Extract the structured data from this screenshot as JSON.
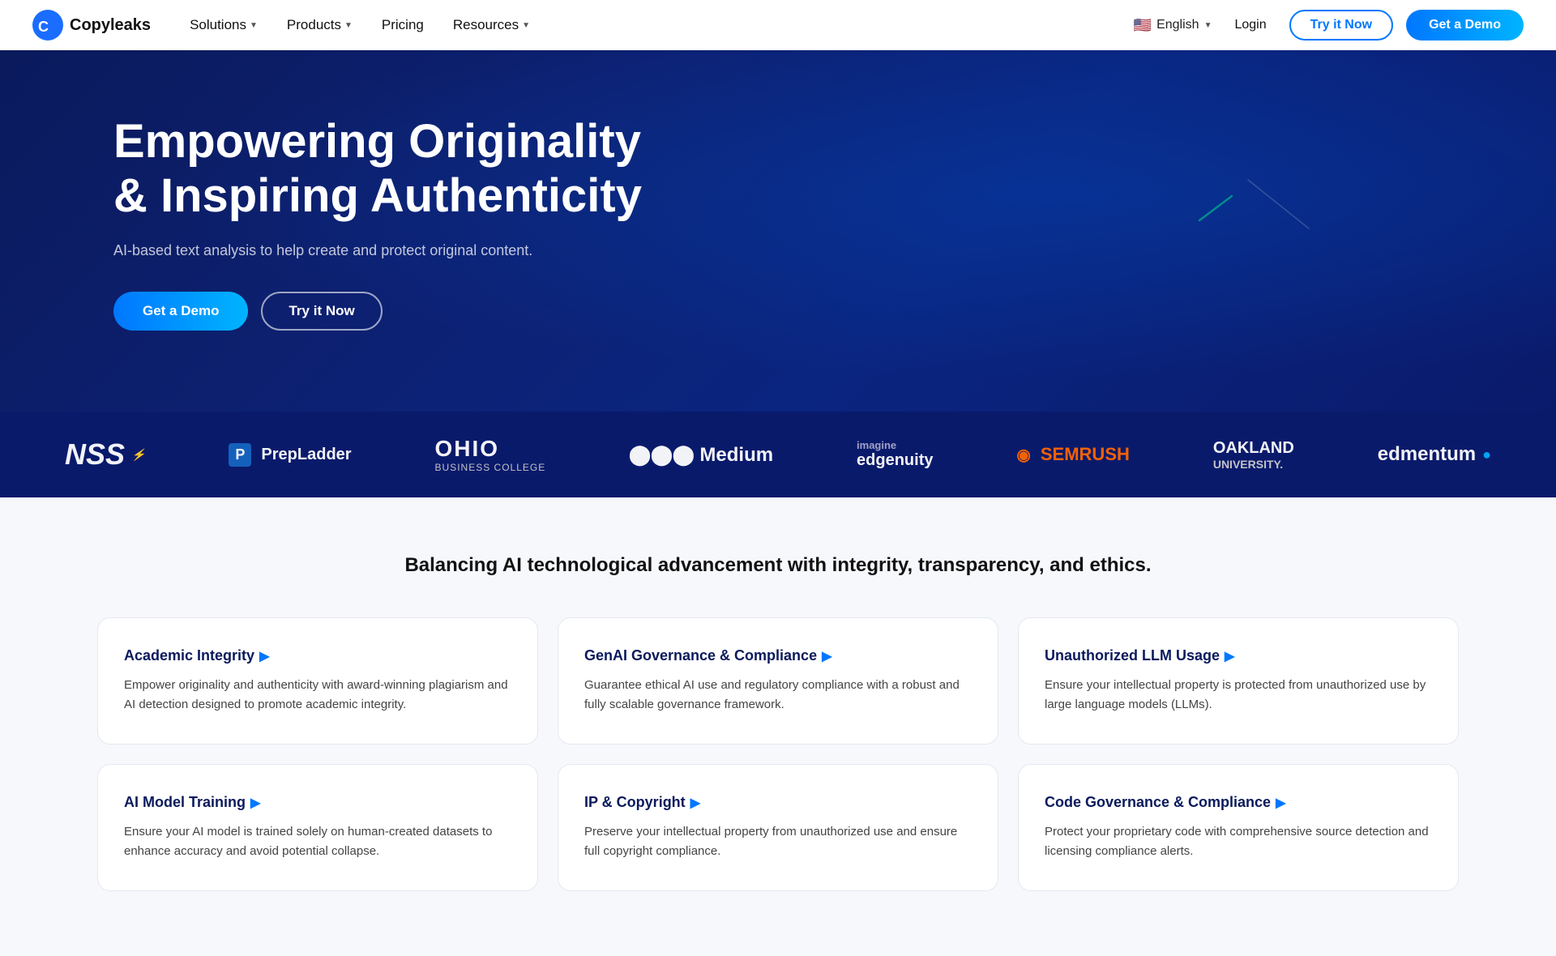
{
  "navbar": {
    "logo_text": "Copyleaks",
    "nav_items": [
      {
        "label": "Solutions",
        "has_dropdown": true
      },
      {
        "label": "Products",
        "has_dropdown": true
      },
      {
        "label": "Pricing",
        "has_dropdown": false
      },
      {
        "label": "Resources",
        "has_dropdown": true
      }
    ],
    "lang": "English",
    "login_label": "Login",
    "try_label": "Try it Now",
    "demo_label": "Get a Demo"
  },
  "hero": {
    "title_line1": "Empowering Originality",
    "title_line2": "& Inspiring Authenticity",
    "subtitle": "AI-based text analysis to help create and protect original content.",
    "demo_btn": "Get a Demo",
    "try_btn": "Try it Now"
  },
  "logos": [
    {
      "name": "NSS",
      "style": "nss"
    },
    {
      "name": "PrepLadder",
      "style": "prepladder"
    },
    {
      "name": "OHIO BUSINESS COLLEGE",
      "style": "ohio"
    },
    {
      "name": "⬤⬤⬤ Medium",
      "style": "medium"
    },
    {
      "name": "≡ imagine edgenuity",
      "style": "edgenuity"
    },
    {
      "name": "SEMRUSH",
      "style": "semrush"
    },
    {
      "name": "OAKLAND UNIVERSITY",
      "style": "oakland"
    },
    {
      "name": "edmentum",
      "style": "edmentum"
    }
  ],
  "features": {
    "headline": "Balancing AI technological advancement with integrity, transparency, and ethics.",
    "cards": [
      {
        "title": "Academic Integrity",
        "desc": "Empower originality and authenticity with award-winning plagiarism and AI detection designed to promote academic integrity."
      },
      {
        "title": "GenAI Governance & Compliance",
        "desc": "Guarantee ethical AI use and regulatory compliance with a robust and fully scalable governance framework."
      },
      {
        "title": "Unauthorized LLM Usage",
        "desc": "Ensure your intellectual property is protected from unauthorized use by large language models (LLMs)."
      },
      {
        "title": "AI Model Training",
        "desc": "Ensure your AI model is trained solely on human-created datasets to enhance accuracy and avoid potential collapse."
      },
      {
        "title": "IP & Copyright",
        "desc": "Preserve your intellectual property from unauthorized use and ensure full copyright compliance."
      },
      {
        "title": "Code Governance & Compliance",
        "desc": "Protect your proprietary code with comprehensive source detection and licensing compliance alerts."
      }
    ]
  }
}
